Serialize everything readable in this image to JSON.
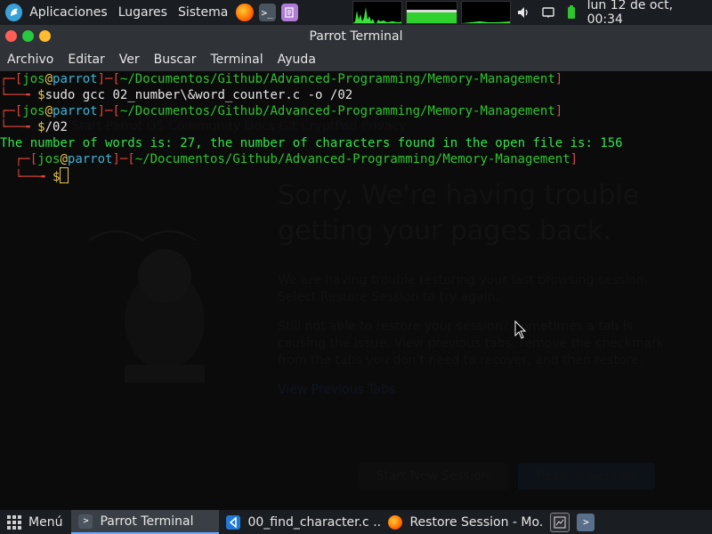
{
  "top_panel": {
    "applications_label": "Aplicaciones",
    "places_label": "Lugares",
    "system_label": "Sistema",
    "launchers": [
      "firefox-icon",
      "terminal-icon",
      "text-editor-icon"
    ],
    "clock": "lun 12 de oct, 00:34"
  },
  "window": {
    "title": "Parrot Terminal"
  },
  "menubar": {
    "items": [
      "Archivo",
      "Editar",
      "Ver",
      "Buscar",
      "Terminal",
      "Ayuda"
    ]
  },
  "terminal": {
    "prompt1": {
      "user": "jos",
      "host": "parrot",
      "path": "~/Documentos/Github/Advanced-Programming/Memory-Management",
      "command": "sudo gcc 02_number\\&word_counter.c -o /02"
    },
    "prompt2": {
      "user": "jos",
      "host": "parrot",
      "path": "~/Documentos/Github/Advanced-Programming/Memory-Management",
      "command": "/02"
    },
    "output": "The number of words is: 27, the number of characters found in the open file is: 156",
    "prompt3": {
      "user": "jos",
      "host": "parrot",
      "path": "~/Documentos/Github/Advanced-Programming/Memory-Management",
      "command": ""
    },
    "colors": {
      "bracket": "#e0443c",
      "user": "#2ec42e",
      "at": "#e8c84a",
      "host": "#3bb5d8",
      "output": "#2ee64a"
    }
  },
  "background_ghost": {
    "title_line1": "Sorry. We're having trouble",
    "title_line2": "getting your pages back.",
    "para1": "We are having trouble restoring your last browsing session. Select Restore Session to try again.",
    "para2": "Still not able to restore your session? Sometimes a tab is causing the issue. View previous tabs, remove the checkmark from the tabs you don't need to recover, and then restore.",
    "view_tabs": "View Previous Tabs",
    "start_new": "Start New Session",
    "restore": "Restore Session",
    "tabs_row": "Started   Start   Parrot OS   Community   Docs   Git   CryptPad   Privacy"
  },
  "taskbar": {
    "menu_label": "Menú",
    "tasks": [
      {
        "label": "Parrot Terminal",
        "icon": "terminal-icon",
        "active": true
      },
      {
        "label": "00_find_character.c ...",
        "icon": "vscode-icon",
        "active": false
      },
      {
        "label": "Restore Session - Mo...",
        "icon": "firefox-icon",
        "active": false
      }
    ],
    "tray": [
      "workspace-icon",
      "terminal-icon"
    ]
  }
}
